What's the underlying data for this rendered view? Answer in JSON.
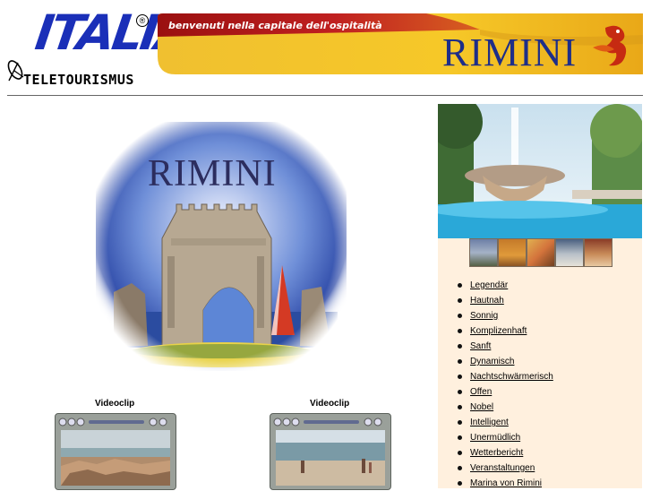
{
  "header": {
    "logo_italia": "ITALIA",
    "logo_registered": "®",
    "logo_teletourismus": "TELETOURISMUS",
    "banner_slogan": "benvenuti nella capitale dell'ospitalità",
    "banner_city": "RIMINI"
  },
  "main": {
    "photo_title": "RIMINI",
    "clips": [
      {
        "label": "Videoclip"
      },
      {
        "label": "Videoclip"
      }
    ]
  },
  "sidebar": {
    "items": [
      {
        "label": "Legendär"
      },
      {
        "label": "Hautnah"
      },
      {
        "label": "Sonnig"
      },
      {
        "label": "Komplizenhaft"
      },
      {
        "label": "Sanft"
      },
      {
        "label": "Dynamisch"
      },
      {
        "label": "Nachtschwärmerisch"
      },
      {
        "label": "Offen"
      },
      {
        "label": "Nobel"
      },
      {
        "label": "Intelligent"
      },
      {
        "label": "Unermüdlich"
      },
      {
        "label": "Wetterbericht"
      },
      {
        "label": "Veranstaltungen"
      },
      {
        "label": "Marina von Rimini"
      }
    ]
  },
  "colors": {
    "logo_blue": "#1a2fb8",
    "banner_gold": "#f2b820",
    "banner_red": "#b01818",
    "rimini_navy": "#1e2e88",
    "panel_beige": "#fff0de"
  },
  "icons": [
    "satellite-dish-icon",
    "red-seahorse-mascot-icon"
  ]
}
